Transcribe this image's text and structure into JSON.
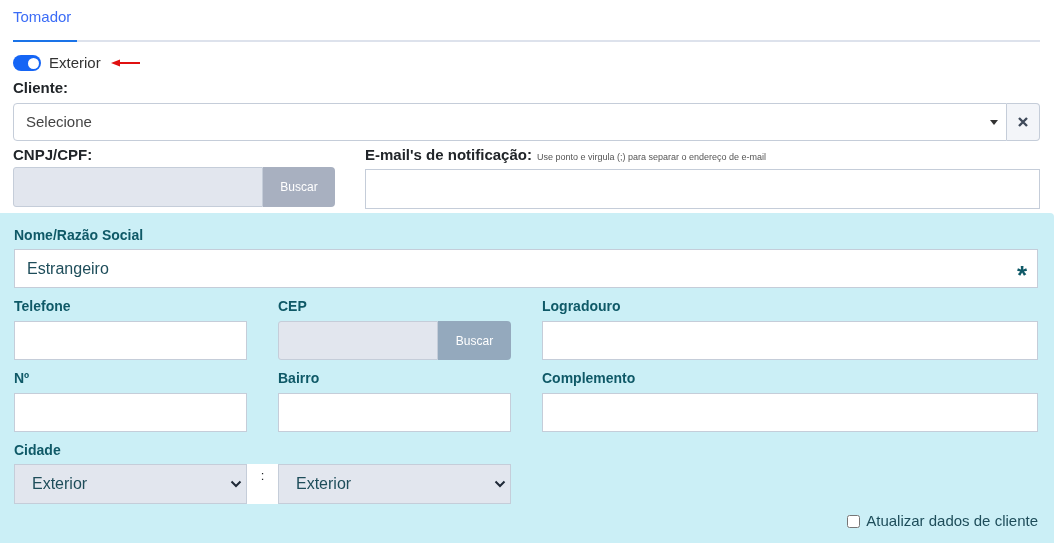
{
  "tab": {
    "label": "Tomador",
    "selected": true
  },
  "exterior_toggle": {
    "label": "Exterior",
    "on": true
  },
  "cliente": {
    "label": "Cliente:",
    "value": "Selecione"
  },
  "cnpj": {
    "label": "CNPJ/CPF:",
    "button": "Buscar",
    "disabled": true
  },
  "email": {
    "label": "E-mail's de notificação:",
    "hint": "Use ponto e virgula (;) para separar o endereço de e-mail"
  },
  "nome": {
    "label": "Nome/Razão Social",
    "value": "Estrangeiro",
    "required_mark": "*"
  },
  "fields": [
    {
      "label": "Telefone",
      "kind": "text"
    },
    {
      "label": "CEP",
      "kind": "search",
      "button": "Buscar"
    },
    {
      "label": "Logradouro",
      "kind": "text"
    },
    {
      "label": "Nº",
      "kind": "text"
    },
    {
      "label": "Bairro",
      "kind": "text"
    },
    {
      "label": "Complemento",
      "kind": "text"
    }
  ],
  "cidade": {
    "label": "Cidade",
    "state": "Exterior",
    "separator": ":",
    "city": "Exterior"
  },
  "update_client": {
    "label": "Atualizar dados de cliente",
    "checked": false
  }
}
